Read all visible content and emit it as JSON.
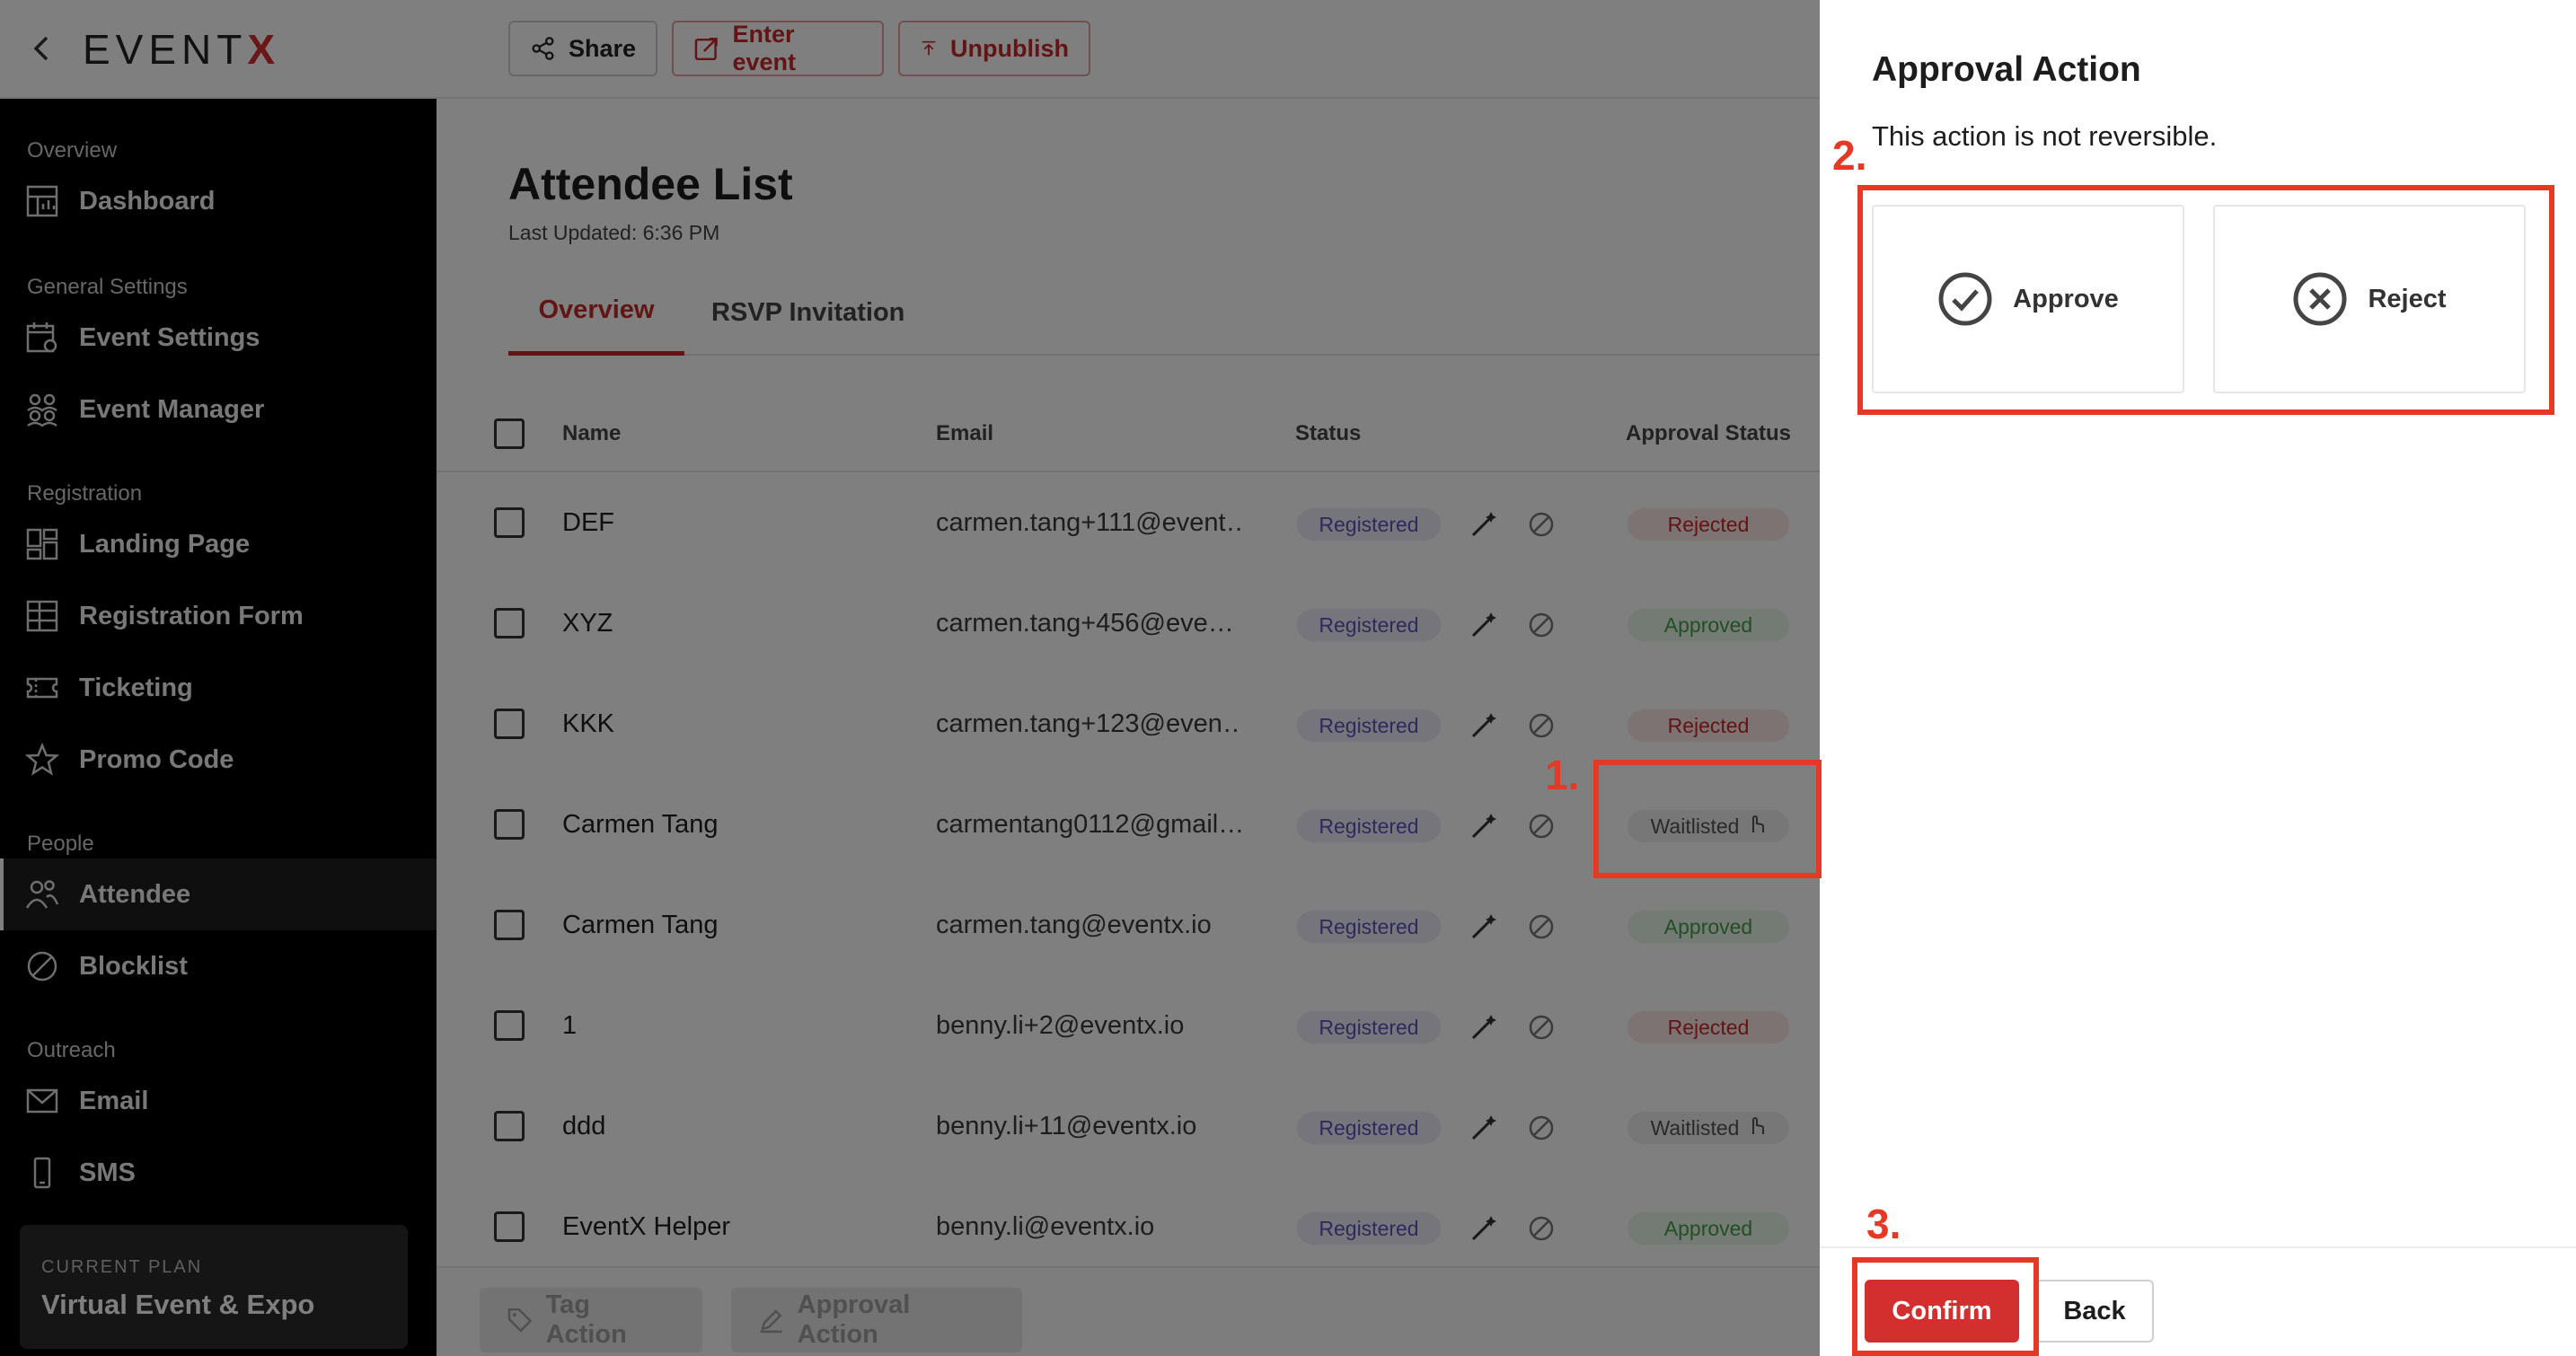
{
  "brand": {
    "logo_text": "EVENT",
    "logo_accent": "X",
    "accent_color": "#d32f2f"
  },
  "toolbar": {
    "share_label": "Share",
    "enter_label": "Enter event",
    "unpublish_label": "Unpublish"
  },
  "sidebar": {
    "sections": {
      "overview": "Overview",
      "general": "General Settings",
      "registration": "Registration",
      "people": "People",
      "outreach": "Outreach"
    },
    "items": {
      "dashboard": "Dashboard",
      "event_settings": "Event Settings",
      "event_manager": "Event Manager",
      "landing_page": "Landing Page",
      "registration_form": "Registration Form",
      "ticketing": "Ticketing",
      "promo_code": "Promo Code",
      "attendee": "Attendee",
      "blocklist": "Blocklist",
      "email": "Email",
      "sms": "SMS"
    },
    "plan": {
      "label": "CURRENT PLAN",
      "value": "Virtual Event & Expo"
    }
  },
  "page": {
    "title": "Attendee List",
    "last_updated": "Last Updated: 6:36 PM",
    "tabs": [
      "Overview",
      "RSVP Invitation"
    ]
  },
  "table": {
    "headers": {
      "name": "Name",
      "email": "Email",
      "status": "Status",
      "approval": "Approval Status"
    },
    "rows": [
      {
        "name": "DEF",
        "email": "carmen.tang+111@event…",
        "status": "Registered",
        "approval": "Rejected"
      },
      {
        "name": "XYZ",
        "email": "carmen.tang+456@eve…",
        "status": "Registered",
        "approval": "Approved"
      },
      {
        "name": "KKK",
        "email": "carmen.tang+123@even…",
        "status": "Registered",
        "approval": "Rejected"
      },
      {
        "name": "Carmen Tang",
        "email": "carmentang0112@gmail…",
        "status": "Registered",
        "approval": "Waitlisted"
      },
      {
        "name": "Carmen Tang",
        "email": "carmen.tang@eventx.io",
        "status": "Registered",
        "approval": "Approved"
      },
      {
        "name": "1",
        "email": "benny.li+2@eventx.io",
        "status": "Registered",
        "approval": "Rejected"
      },
      {
        "name": "ddd",
        "email": "benny.li+11@eventx.io",
        "status": "Registered",
        "approval": "Waitlisted"
      },
      {
        "name": "EventX Helper",
        "email": "benny.li@eventx.io",
        "status": "Registered",
        "approval": "Approved"
      }
    ]
  },
  "bottom_bar": {
    "tag_action": "Tag Action",
    "approval_action": "Approval Action"
  },
  "drawer": {
    "title": "Approval Action",
    "subtitle": "This action is not reversible.",
    "approve_label": "Approve",
    "reject_label": "Reject",
    "confirm_label": "Confirm",
    "back_label": "Back"
  },
  "annotations": {
    "step1": "1.",
    "step2": "2.",
    "step3": "3.",
    "color": "#e53925"
  }
}
